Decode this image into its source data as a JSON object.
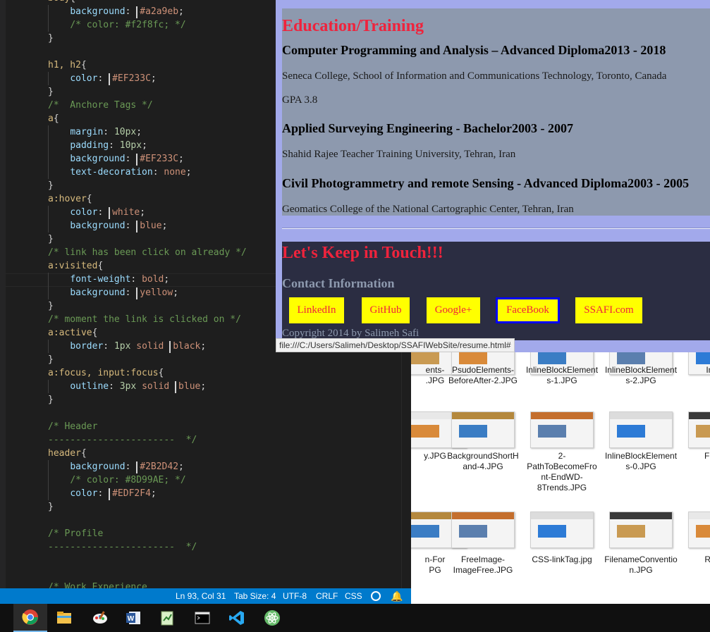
{
  "editor": {
    "lines": [
      [
        [
          "sel",
          "body"
        ],
        [
          "pun",
          "{"
        ]
      ],
      [
        [
          "pun",
          "    "
        ],
        [
          "prop",
          "background"
        ],
        [
          "pun",
          ": "
        ],
        [
          "swatch",
          "#a2a9eb"
        ],
        [
          "val",
          "#a2a9eb"
        ],
        [
          "pun",
          ";"
        ]
      ],
      [
        [
          "pun",
          "    "
        ],
        [
          "cmt",
          "/* color: #f2f8fc; */"
        ]
      ],
      [
        [
          "pun",
          "}"
        ]
      ],
      [],
      [
        [
          "sel",
          "h1, h2"
        ],
        [
          "pun",
          "{"
        ]
      ],
      [
        [
          "pun",
          "    "
        ],
        [
          "prop",
          "color"
        ],
        [
          "pun",
          ": "
        ],
        [
          "swatch",
          "#EF233C"
        ],
        [
          "val",
          "#EF233C"
        ],
        [
          "pun",
          ";"
        ]
      ],
      [
        [
          "pun",
          "}"
        ]
      ],
      [
        [
          "cmt",
          "/*  Anchore Tags */"
        ]
      ],
      [
        [
          "sel",
          "a"
        ],
        [
          "pun",
          "{"
        ]
      ],
      [
        [
          "pun",
          "    "
        ],
        [
          "prop",
          "margin"
        ],
        [
          "pun",
          ": "
        ],
        [
          "num",
          "10px"
        ],
        [
          "pun",
          ";"
        ]
      ],
      [
        [
          "pun",
          "    "
        ],
        [
          "prop",
          "padding"
        ],
        [
          "pun",
          ": "
        ],
        [
          "num",
          "10px"
        ],
        [
          "pun",
          ";"
        ]
      ],
      [
        [
          "pun",
          "    "
        ],
        [
          "prop",
          "background"
        ],
        [
          "pun",
          ": "
        ],
        [
          "swatch",
          "#EF233C"
        ],
        [
          "val",
          "#EF233C"
        ],
        [
          "pun",
          ";"
        ]
      ],
      [
        [
          "pun",
          "    "
        ],
        [
          "prop",
          "text-decoration"
        ],
        [
          "pun",
          ": "
        ],
        [
          "val",
          "none"
        ],
        [
          "pun",
          ";"
        ]
      ],
      [
        [
          "pun",
          "}"
        ]
      ],
      [
        [
          "sel",
          "a:hover"
        ],
        [
          "pun",
          "{"
        ]
      ],
      [
        [
          "pun",
          "    "
        ],
        [
          "prop",
          "color"
        ],
        [
          "pun",
          ": "
        ],
        [
          "swatch",
          "#ffffff"
        ],
        [
          "val",
          "white"
        ],
        [
          "pun",
          ";"
        ]
      ],
      [
        [
          "pun",
          "    "
        ],
        [
          "prop",
          "background"
        ],
        [
          "pun",
          ": "
        ],
        [
          "swatch",
          "#0000ff"
        ],
        [
          "val",
          "blue"
        ],
        [
          "pun",
          ";"
        ]
      ],
      [
        [
          "pun",
          "}"
        ]
      ],
      [
        [
          "cmt",
          "/* link has been click on already */"
        ]
      ],
      [
        [
          "sel",
          "a:visited"
        ],
        [
          "pun",
          "{"
        ]
      ],
      [
        [
          "pun",
          "    "
        ],
        [
          "prop",
          "font-weight"
        ],
        [
          "pun",
          ": "
        ],
        [
          "val",
          "bold"
        ],
        [
          "pun",
          ";"
        ]
      ],
      [
        [
          "pun",
          "    "
        ],
        [
          "prop",
          "background"
        ],
        [
          "pun",
          ": "
        ],
        [
          "swatch",
          "#ffff00"
        ],
        [
          "val",
          "yellow"
        ],
        [
          "pun",
          ";"
        ]
      ],
      [
        [
          "pun",
          "}"
        ]
      ],
      [
        [
          "cmt",
          "/* moment the link is clicked on */"
        ]
      ],
      [
        [
          "sel",
          "a:active"
        ],
        [
          "pun",
          "{"
        ]
      ],
      [
        [
          "pun",
          "    "
        ],
        [
          "prop",
          "border"
        ],
        [
          "pun",
          ": "
        ],
        [
          "num",
          "1px"
        ],
        [
          "pun",
          " "
        ],
        [
          "val",
          "solid "
        ],
        [
          "swatch",
          "#000000"
        ],
        [
          "val",
          "black"
        ],
        [
          "pun",
          ";"
        ]
      ],
      [
        [
          "pun",
          "}"
        ]
      ],
      [
        [
          "sel",
          "a:focus, input:focus"
        ],
        [
          "pun",
          "{"
        ]
      ],
      [
        [
          "pun",
          "    "
        ],
        [
          "prop",
          "outline"
        ],
        [
          "pun",
          ": "
        ],
        [
          "num",
          "3px"
        ],
        [
          "pun",
          " "
        ],
        [
          "val",
          "solid "
        ],
        [
          "swatch",
          "#0000ff"
        ],
        [
          "val",
          "blue"
        ],
        [
          "pun",
          ";"
        ]
      ],
      [
        [
          "pun",
          "}"
        ]
      ],
      [],
      [
        [
          "cmt",
          "/* Header"
        ]
      ],
      [
        [
          "cmt",
          "-----------------------  */"
        ]
      ],
      [
        [
          "sel",
          "header"
        ],
        [
          "pun",
          "{"
        ]
      ],
      [
        [
          "pun",
          "    "
        ],
        [
          "prop",
          "background"
        ],
        [
          "pun",
          ": "
        ],
        [
          "swatch",
          "#2B2D42"
        ],
        [
          "val",
          "#2B2D42"
        ],
        [
          "pun",
          ";"
        ]
      ],
      [
        [
          "pun",
          "    "
        ],
        [
          "cmt",
          "/* color: #8D99AE; */"
        ]
      ],
      [
        [
          "pun",
          "    "
        ],
        [
          "prop",
          "color"
        ],
        [
          "pun",
          ": "
        ],
        [
          "swatch",
          "#EDF2F4"
        ],
        [
          "val",
          "#EDF2F4"
        ],
        [
          "pun",
          ";"
        ]
      ],
      [
        [
          "pun",
          "}"
        ]
      ],
      [],
      [
        [
          "cmt",
          "/* Profile"
        ]
      ],
      [
        [
          "cmt",
          "-----------------------  */"
        ]
      ],
      [],
      [],
      [
        [
          "cmt",
          "/* Work Experience"
        ]
      ]
    ]
  },
  "statusbar": {
    "position": "Ln 93, Col 31",
    "tab_size": "Tab Size: 4",
    "encoding": "UTF-8",
    "eol": "CRLF",
    "language": "CSS"
  },
  "browser": {
    "education_title": "Education/Training",
    "entries": [
      {
        "degree": "Computer Programming and Analysis – Advanced Diploma2013 - 2018",
        "school": "Seneca College, School of Information and Communications Technology, Toronto, Canada",
        "gpa": "GPA 3.8"
      },
      {
        "degree": "Applied Surveying Engineering - Bachelor2003 - 2007",
        "school": "Shahid Rajee Teacher Training University, Tehran, Iran"
      },
      {
        "degree": "Civil Photogrammetry and remote Sensing - Advanced Diploma2003 - 2005",
        "school": "Geomatics College of the National Cartographic Center, Tehran, Iran"
      }
    ],
    "contact_title": "Let's Keep in Touch!!!",
    "contact_subtitle": "Contact Information",
    "links": [
      "LinkedIn",
      "GitHub",
      "Google+",
      "FaceBook",
      "SSAFI.com"
    ],
    "copyright": "Copyright 2014 by Salimeh Safi",
    "status_url": "file:///C:/Users/Salimeh/Desktop/SSAFIWebSite/resume.html#"
  },
  "explorer": {
    "row1": [
      "ents-\n.JPG",
      "PsudoElements-BeforeAfter-2.JPG",
      "InlineBlockElements-1.JPG",
      "InlineBlockElements-2.JPG",
      "InlineBl\nents-"
    ],
    "row2": [
      "y.JPG",
      "BackgroundShortHand-4.JPG",
      "2-PathToBecomeFront-EndWD-8Trends.JPG",
      "InlineBlockElements-0.JPG",
      "FloatEle"
    ],
    "row3": [
      "n-For\nPG",
      "FreeImage-ImageFree.JPG",
      "CSS-linkTag.jpg",
      "FilenameConvention.JPG",
      "Relative"
    ]
  },
  "taskbar": {
    "apps": [
      "chrome-icon",
      "file-explorer-icon",
      "paint-icon",
      "word-icon",
      "notepad-icon",
      "terminal-icon",
      "vscode-icon",
      "atom-icon"
    ]
  },
  "colors": {
    "page_bg": "#a2a9eb",
    "section_bg": "#8d99ae",
    "header_bg": "#2b2d42",
    "accent": "#ef233c",
    "link_bg": "#ffff00",
    "focus": "#0000ff",
    "statusbar": "#007acc"
  }
}
